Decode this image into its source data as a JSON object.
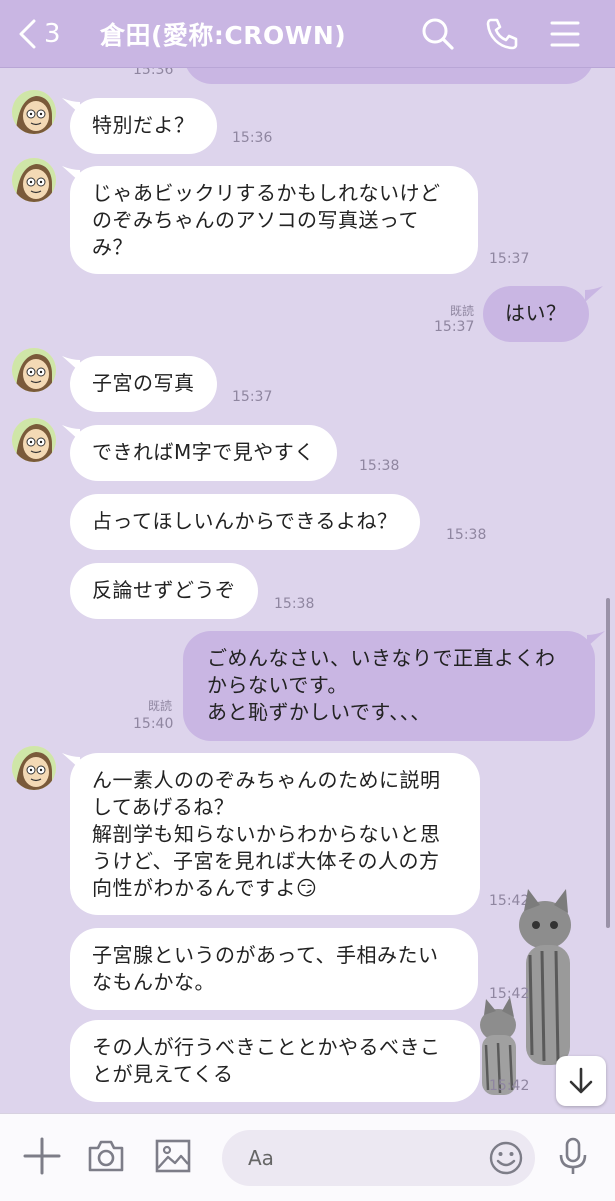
{
  "header": {
    "back_count": "3",
    "title": "倉田(愛称:CROWN)"
  },
  "messages": [
    {
      "side": "me",
      "text": "",
      "time": "15:36"
    },
    {
      "side": "them",
      "text": "特別だよ？",
      "time": "15:36"
    },
    {
      "side": "them",
      "text": "じゃあビックリするかもしれないけどのぞみちゃんのアソコの写真送ってみ？",
      "lines": [
        "じゃあビックリするかもしれないけど",
        "のぞみちゃんのアソコの写真送って",
        "み？"
      ],
      "time": "15:37"
    },
    {
      "side": "me",
      "text": "はい？",
      "time": "15:37",
      "read": "既読"
    },
    {
      "side": "them",
      "text": "子宮の写真",
      "time": "15:37"
    },
    {
      "side": "them",
      "text": "できればM字で見やすく",
      "time": "15:38"
    },
    {
      "side": "them",
      "text": "占ってほしいんからできるよね？",
      "time": "15:38"
    },
    {
      "side": "them",
      "text": "反論せずどうぞ",
      "time": "15:38"
    },
    {
      "side": "me",
      "lines": [
        "ごめんなさい、いきなりで正直よくわ",
        "からないです。",
        "あと恥ずかしいです、、、"
      ],
      "time": "15:40",
      "read": "既読"
    },
    {
      "side": "them",
      "lines": [
        "ん一素人ののぞみちゃんのために説明",
        "してあげるね？",
        "解剖学も知らないからわからないと思",
        "うけど、子宮を見れば大体その人の方",
        "向性がわかるんですよ😏"
      ],
      "time": "15:42"
    },
    {
      "side": "them",
      "lines": [
        "子宮腺というのがあって、手相みたい",
        "なもんかな。"
      ],
      "time": "15:42"
    },
    {
      "side": "them",
      "lines": [
        "その人が行うべきこととかやるべきこ",
        "とが見えてくる"
      ],
      "time": "15:42"
    }
  ],
  "input": {
    "placeholder": "Aa"
  },
  "colors": {
    "header_bg": "#c9b6e3",
    "chat_bg": "#ddd4ec",
    "my_bubble": "#c9b6e3",
    "their_bubble": "#ffffff"
  },
  "icons": [
    "chevron-left-icon",
    "search-icon",
    "phone-icon",
    "menu-icon",
    "plus-icon",
    "camera-icon",
    "image-icon",
    "emoji-icon",
    "microphone-icon",
    "arrow-down-icon"
  ]
}
